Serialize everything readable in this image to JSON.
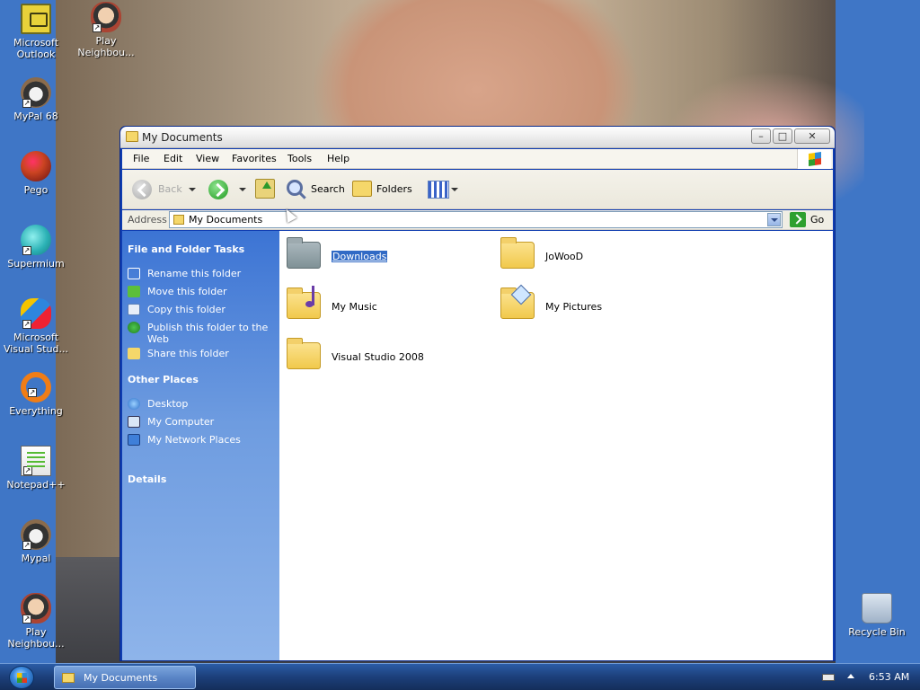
{
  "desktop": {
    "icons": [
      {
        "line1": "Microsoft",
        "line2": "Outlook",
        "icon": "outlook-icon"
      },
      {
        "line1": "Play",
        "line2": "Neighbou...",
        "icon": "play-neighbours-icon"
      },
      {
        "line1": "MyPal 68",
        "line2": "",
        "icon": "mypal-icon"
      },
      {
        "line1": "Pego",
        "line2": "",
        "icon": "pego-icon"
      },
      {
        "line1": "Supermium",
        "line2": "",
        "icon": "supermium-icon"
      },
      {
        "line1": "Microsoft",
        "line2": "Visual Stud...",
        "icon": "visual-studio-icon"
      },
      {
        "line1": "Everything",
        "line2": "",
        "icon": "everything-icon"
      },
      {
        "line1": "Notepad++",
        "line2": "",
        "icon": "notepad-plus-plus-icon"
      },
      {
        "line1": "Mypal",
        "line2": "",
        "icon": "mypal-icon"
      },
      {
        "line1": "Play",
        "line2": "Neighbou...",
        "icon": "play-neighbours-icon"
      },
      {
        "line1": "Recycle Bin",
        "line2": "",
        "icon": "recycle-bin-icon"
      }
    ]
  },
  "window": {
    "title": "My Documents",
    "buttons": {
      "minimize": "–",
      "maximize": "□",
      "close": "✕"
    },
    "menu": [
      "File",
      "Edit",
      "View",
      "Favorites",
      "Tools",
      "Help"
    ],
    "toolbar": {
      "back": "Back",
      "search": "Search",
      "folders": "Folders"
    },
    "address": {
      "label": "Address",
      "value": "My Documents",
      "go": "Go"
    },
    "taskpane": {
      "file_tasks_header": "File and Folder Tasks",
      "file_tasks": [
        "Rename this folder",
        "Move this folder",
        "Copy this folder",
        "Publish this folder to the Web",
        "Share this folder"
      ],
      "other_places_header": "Other Places",
      "other_places": [
        "Desktop",
        "My Computer",
        "My Network Places"
      ],
      "details_header": "Details"
    },
    "items": [
      {
        "name": "Downloads",
        "selected": true
      },
      {
        "name": "JoWooD"
      },
      {
        "name": "My Music"
      },
      {
        "name": "My Pictures"
      },
      {
        "name": "Visual Studio 2008"
      }
    ]
  },
  "taskbar": {
    "task_button": "My Documents",
    "clock": "6:53 AM"
  }
}
